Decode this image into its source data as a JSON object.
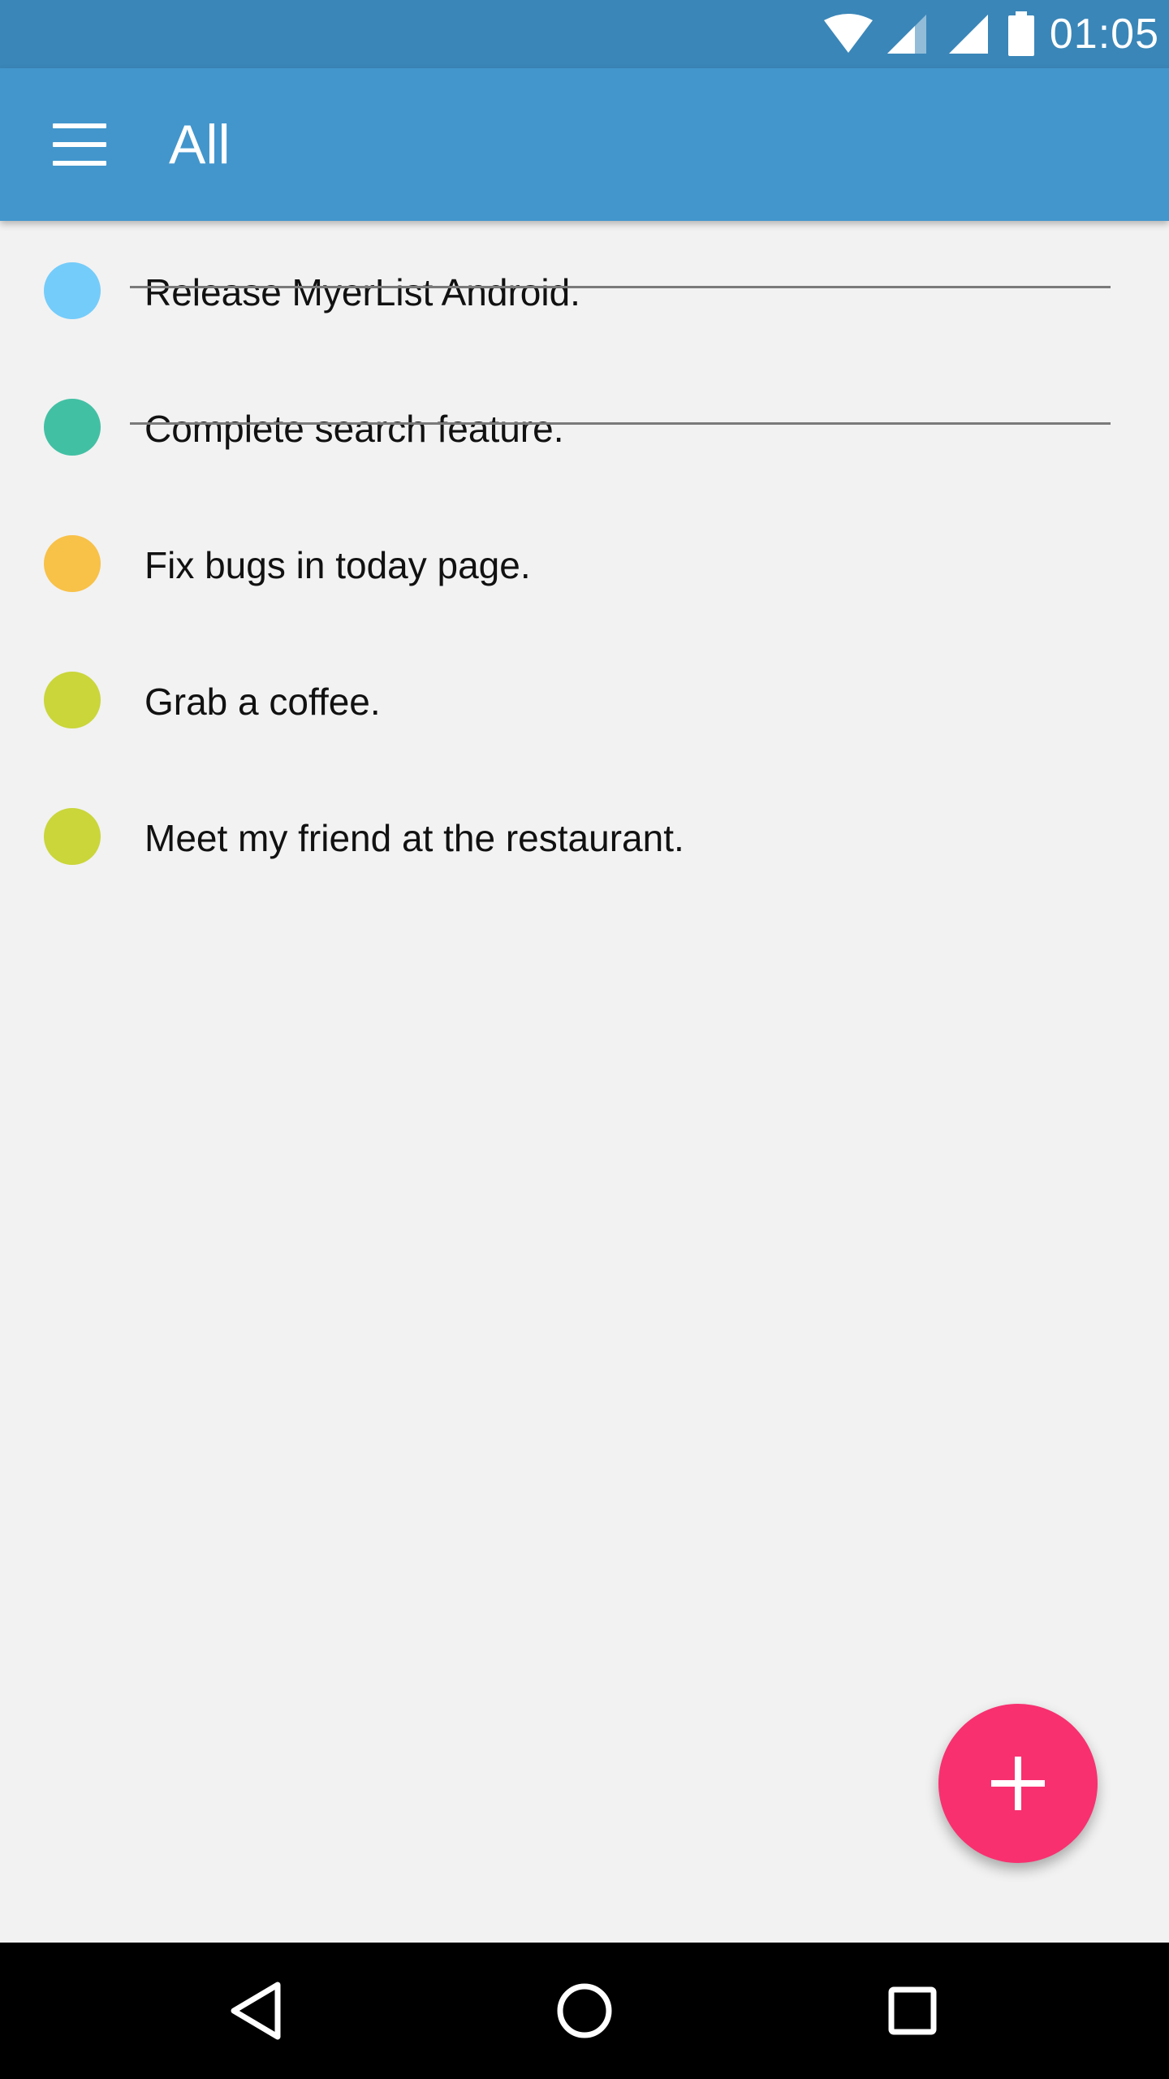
{
  "status_bar": {
    "time": "01:05",
    "icons": [
      "wifi-icon",
      "signal-icon",
      "signal-icon",
      "battery-icon"
    ],
    "color": "#3A86B8"
  },
  "app_bar": {
    "title": "All",
    "menu_icon": "hamburger-menu-icon",
    "color": "#4296CC"
  },
  "tasks": [
    {
      "label": "Release MyerList Android.",
      "color": "#74CCFA",
      "completed": true
    },
    {
      "label": "Complete search feature.",
      "color": "#42C0A4",
      "completed": true
    },
    {
      "label": "Fix bugs in today page.",
      "color": "#F8C148",
      "completed": false
    },
    {
      "label": "Grab a coffee.",
      "color": "#CAD63A",
      "completed": false
    },
    {
      "label": "Meet my friend at the restaurant.",
      "color": "#CAD63A",
      "completed": false
    }
  ],
  "fab": {
    "icon": "plus-icon",
    "color": "#F83070"
  },
  "nav_bar": {
    "buttons": [
      "back-icon",
      "home-icon",
      "recents-icon"
    ]
  }
}
